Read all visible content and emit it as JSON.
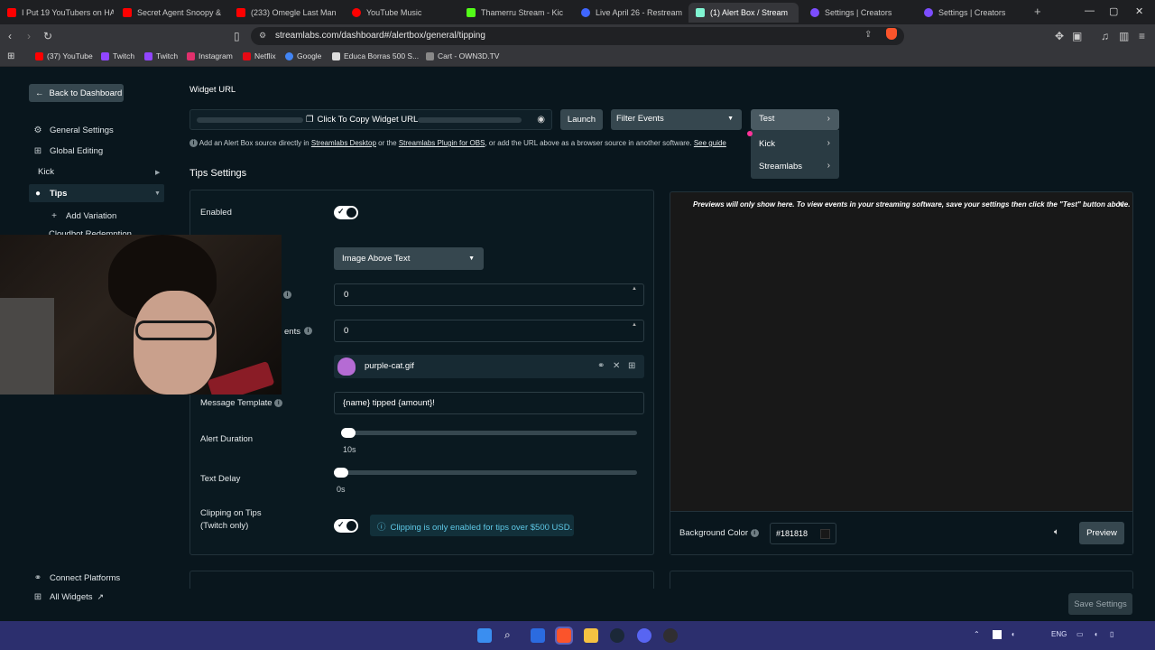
{
  "browser": {
    "tabs": [
      {
        "label": "I Put 19 YouTubers on HA",
        "color": "#ff0000"
      },
      {
        "label": "Secret Agent Snoopy & m",
        "color": "#ff0000"
      },
      {
        "label": "(233) Omegle Last Man St",
        "color": "#ff0000"
      },
      {
        "label": "YouTube Music",
        "color": "#ff0000"
      },
      {
        "label": "Thamerru Stream - Kic",
        "color": "#53fc18"
      },
      {
        "label": "Live April 26 - Restream",
        "color": "#3f66ff"
      },
      {
        "label": "(1) Alert Box / Stream",
        "color": "#80f5d2"
      },
      {
        "label": "Settings | Creators",
        "color": "#7c4dff"
      },
      {
        "label": "Settings | Creators",
        "color": "#7c4dff"
      }
    ],
    "url": "streamlabs.com/dashboard#/alertbox/general/tipping",
    "bookmarks": [
      {
        "label": "(37) YouTube",
        "color": "#ff0000"
      },
      {
        "label": "Twitch",
        "color": "#9146ff"
      },
      {
        "label": "Twitch",
        "color": "#9146ff"
      },
      {
        "label": "Instagram",
        "color": "#e1306c"
      },
      {
        "label": "Netflix",
        "color": "#e50914"
      },
      {
        "label": "Google",
        "color": "#4285f4"
      },
      {
        "label": "Educa Borras 500 S...",
        "color": "#dddddd"
      },
      {
        "label": "Cart - OWN3D.TV",
        "color": "#888888"
      }
    ]
  },
  "sidebar": {
    "back_label": "Back to Dashboard",
    "items": [
      {
        "label": "General Settings",
        "icon": "gear-icon"
      },
      {
        "label": "Global Editing",
        "icon": "grid-icon"
      },
      {
        "label": "Kick"
      },
      {
        "label": "Tips",
        "icon": "tips-icon"
      },
      {
        "label": "Add Variation",
        "icon": "plus-icon"
      },
      {
        "label": "Cloudbot Redemption"
      }
    ],
    "footer": [
      {
        "label": "Connect Platforms",
        "icon": "link-icon"
      },
      {
        "label": "All Widgets",
        "icon": "widgets-icon"
      }
    ]
  },
  "widget": {
    "url_label": "Widget URL",
    "copy_label": "Click To Copy Widget URL",
    "launch_label": "Launch",
    "filter_label": "Filter Events",
    "test_label": "Test",
    "test_menu": [
      "Kick",
      "Streamlabs"
    ],
    "info": {
      "prefix": "Add an Alert Box source directly in",
      "link1": "Streamlabs Desktop",
      "mid": "or the",
      "link2": "Streamlabs Plugin for OBS",
      "suffix": ", or add the URL above as a browser source in another software.",
      "link3": "See guide"
    }
  },
  "tips": {
    "section_title": "Tips Settings",
    "enabled_label": "Enabled",
    "layout_value": "Image Above Text",
    "field_min_value": "0",
    "field_min_partial_label": "ents",
    "field_min_amount_value": "0",
    "file_name": "purple-cat.gif",
    "message_label": "Message Template",
    "message_value": "{name} tipped {amount}!",
    "alert_duration_label": "Alert Duration",
    "alert_duration_value": "10s",
    "text_delay_label": "Text Delay",
    "text_delay_value": "0s",
    "clipping_label": "Clipping on Tips (Twitch only)",
    "clipping_note": "Clipping is only enabled for tips over $500 USD."
  },
  "preview": {
    "note": "Previews will only show here. To view events in your streaming software, save your settings then click the \"Test\" button above.",
    "bg_label": "Background Color",
    "bg_value": "#181818",
    "preview_label": "Preview",
    "save_label": "Save Settings"
  },
  "taskbar": {
    "lang": "ENG"
  }
}
